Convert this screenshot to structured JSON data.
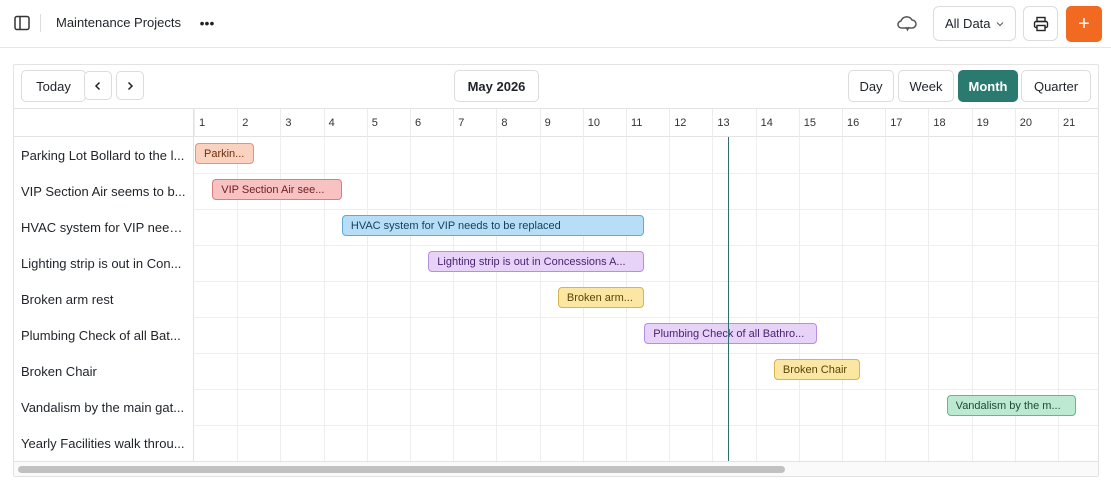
{
  "header": {
    "title": "Maintenance Projects",
    "more_label": "•••",
    "data_filter": "All Data",
    "add_label": "+"
  },
  "toolbar": {
    "today_label": "Today",
    "prev_icon": "chevron-left-icon",
    "next_icon": "chevron-right-icon",
    "period": "May 2026",
    "views": [
      "Day",
      "Week",
      "Month",
      "Quarter"
    ],
    "active_view": "Month"
  },
  "days": [
    "1",
    "2",
    "3",
    "4",
    "5",
    "6",
    "7",
    "8",
    "9",
    "10",
    "11",
    "12",
    "13",
    "14",
    "15",
    "16",
    "17",
    "18",
    "19",
    "20",
    "21"
  ],
  "today_marker": {
    "date": "May 13, 2026",
    "day_fraction": 13.35,
    "color": "#2f6f6b"
  },
  "colors": {
    "accent": "#2a7a6f",
    "add_button": "#f26a21",
    "orange_bar": "#fbd1bf",
    "red_bar": "#f8c2c2",
    "blue_bar": "#b7def6",
    "purple_bar": "#e7d3f8",
    "yellow_bar": "#fbe6a3",
    "green_bar": "#bde8d2"
  },
  "tasks": [
    {
      "name": "Parking Lot Bollard to the l...",
      "bar_label": "Parkin...",
      "start": 1.0,
      "end": 2.37,
      "bg": "#fbd1bf",
      "border": "#e8946e",
      "color": "#6b3010"
    },
    {
      "name": "VIP Section Air seems to b...",
      "bar_label": "VIP Section Air see...",
      "start": 1.4,
      "end": 4.4,
      "bg": "#f8c2c2",
      "border": "#de7b7b",
      "color": "#6b1f1f"
    },
    {
      "name": "HVAC system for VIP need...",
      "bar_label": "HVAC system for VIP needs to be replaced",
      "start": 4.4,
      "end": 11.4,
      "bg": "#b7def6",
      "border": "#5fa9d8",
      "color": "#123f5c"
    },
    {
      "name": "Lighting strip is out in Con...",
      "bar_label": "Lighting strip is out in Concessions A...",
      "start": 6.4,
      "end": 11.4,
      "bg": "#e7d3f8",
      "border": "#b98de0",
      "color": "#4b2270"
    },
    {
      "name": "Broken arm rest",
      "bar_label": "Broken arm...",
      "start": 9.4,
      "end": 11.4,
      "bg": "#fbe6a3",
      "border": "#d8b44c",
      "color": "#5b4408"
    },
    {
      "name": "Plumbing Check of all Bat...",
      "bar_label": "Plumbing Check of all Bathro...",
      "start": 11.4,
      "end": 15.4,
      "bg": "#e7d3f8",
      "border": "#b98de0",
      "color": "#4b2270"
    },
    {
      "name": "Broken Chair",
      "bar_label": "Broken Chair",
      "start": 14.4,
      "end": 16.4,
      "bg": "#fbe6a3",
      "border": "#d8b44c",
      "color": "#5b4408"
    },
    {
      "name": "Vandalism by the main gat...",
      "bar_label": "Vandalism by the m...",
      "start": 18.4,
      "end": 21.4,
      "bg": "#bde8d2",
      "border": "#62b690",
      "color": "#1b4d36"
    },
    {
      "name": "Yearly Facilities walk throu...",
      "bar_label": "",
      "start": null,
      "end": null,
      "bg": "",
      "border": "",
      "color": ""
    }
  ],
  "scrollbar": {
    "visible_fraction": 0.71
  }
}
